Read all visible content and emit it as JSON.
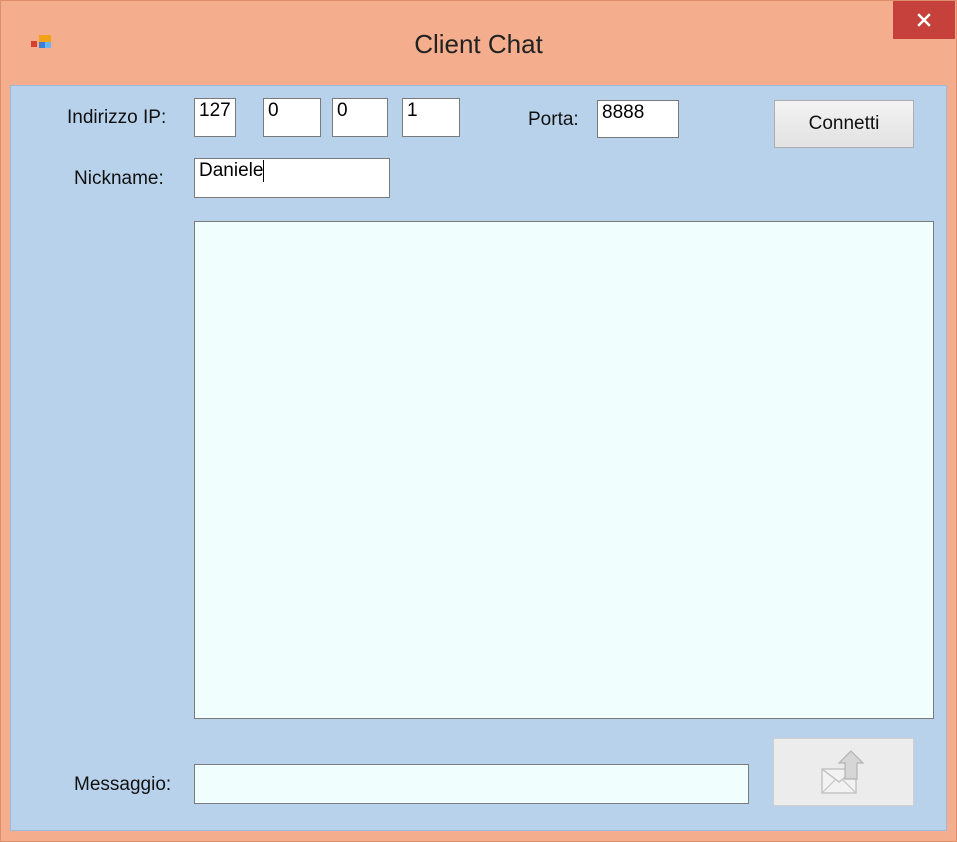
{
  "window": {
    "title": "Client Chat",
    "close_glyph": "✕",
    "app_icon": "app-form-icon"
  },
  "connection": {
    "ip_label": "Indirizzo IP:",
    "ip_octets": [
      "127",
      "0",
      "0",
      "1"
    ],
    "port_label": "Porta:",
    "port_value": "8888",
    "connect_label": "Connetti"
  },
  "nickname": {
    "label": "Nickname:",
    "value": "Daniele"
  },
  "chat_log": {
    "messages": []
  },
  "message": {
    "label": "Messaggio:",
    "value": "",
    "send_icon": "send-envelope-icon",
    "send_enabled": false
  },
  "colors": {
    "title_bar": "#f4ae8e",
    "close_button": "#c7413c",
    "client_area": "#b9d2ec",
    "text_area": "#f0fffe"
  }
}
